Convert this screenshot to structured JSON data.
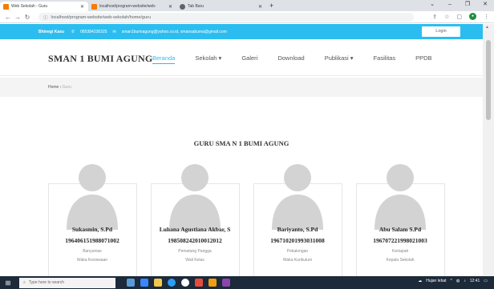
{
  "browser": {
    "tabs": [
      {
        "label": "Web Sekolah - Guru",
        "color": "#f57c00"
      },
      {
        "label": "localhost/program-website/web-",
        "color": "#f57c00"
      },
      {
        "label": "Tab Baru",
        "color": "#5f6368"
      }
    ],
    "new_tab": "+",
    "url": "localhost/program-website/web-sekolah/home/guru"
  },
  "topinfo": {
    "brand": "Bhinegi Kasu",
    "phone": "085384236325",
    "emails": "sman1bumiagung@yahoo.co.id, smansabuma@gmail.com",
    "login_label": "Login"
  },
  "site": {
    "logo": "SMAN 1 BUMI AGUNG",
    "menu": [
      "Beranda",
      "Sekolah ▾",
      "Galeri",
      "Download",
      "Publikasi ▾",
      "Fasilitas",
      "PPDB"
    ],
    "accent": "#2cbdf0"
  },
  "breadcrumb": {
    "home": "Home",
    "sep": "›",
    "current": "Guru"
  },
  "section_title": "GURU SMA N 1 BUMI AGUNG",
  "teachers": [
    {
      "name": "Sukasmin, S.Pd",
      "nip": "196406151988071002",
      "place": "Banyumas",
      "role": "Waka Kesiswaan"
    },
    {
      "name": "Luhana Agustiana Akbar, S",
      "nip": "198508242010012012",
      "place": "Pematang Pangga",
      "role": "Wali Kelas"
    },
    {
      "name": "Bariyanto, S.Pd",
      "nip": "196710201993031008",
      "place": "Pekalongan",
      "role": "Waka Kurikulum"
    },
    {
      "name": "Abu Salam S.Pd",
      "nip": "196707221998021003",
      "place": "Kertapati",
      "role": "Kepala Sekolah"
    }
  ],
  "taskbar": {
    "search_placeholder": "Type here to search",
    "tray_text": "Hujan lebat",
    "time": "12:41"
  }
}
